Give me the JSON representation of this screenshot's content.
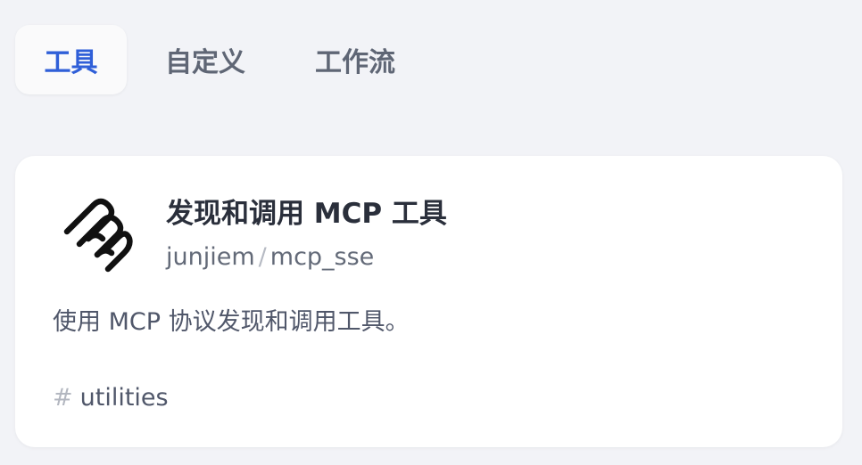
{
  "tabs": [
    {
      "label": "工具",
      "active": true
    },
    {
      "label": "自定义",
      "active": false
    },
    {
      "label": "工作流",
      "active": false
    }
  ],
  "card": {
    "title": "发现和调用 MCP 工具",
    "author": "junjiem",
    "separator": "/",
    "name": "mcp_sse",
    "description": "使用 MCP 协议发现和调用工具。",
    "tag_symbol": "#",
    "tag": "utilities",
    "logo_icon": "mcp-logo-icon"
  },
  "colors": {
    "background": "#f2f3f7",
    "active_tab_text": "#2f5fd8",
    "inactive_tab_text": "#5f6675",
    "card_background": "#ffffff",
    "title_text": "#2a2f3b"
  }
}
